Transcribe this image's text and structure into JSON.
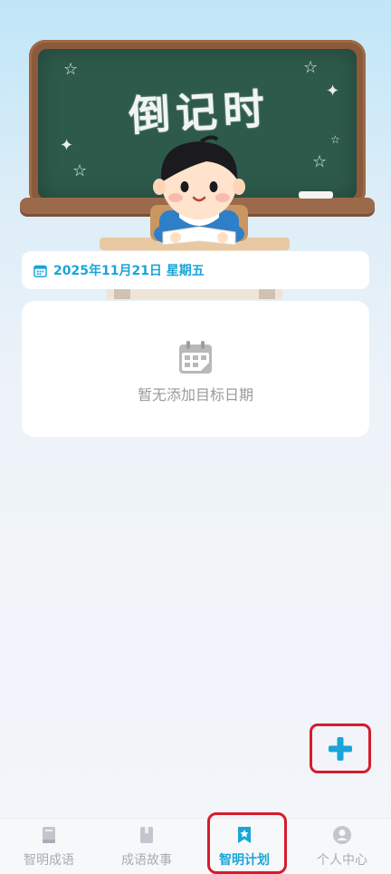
{
  "hero": {
    "board_title": "倒记时",
    "icons": [
      "star-icon",
      "sparkle-icon"
    ]
  },
  "date_bar": {
    "icon": "calendar-icon",
    "text": "2025年11月21日 星期五"
  },
  "empty_state": {
    "icon": "calendar-grid-icon",
    "text": "暂无添加目标日期"
  },
  "fab": {
    "icon": "plus-icon",
    "color": "#1aa5d9"
  },
  "bottom_nav": {
    "items": [
      {
        "label": "智明成语",
        "icon": "book-icon",
        "active": false
      },
      {
        "label": "成语故事",
        "icon": "bookmark-book-icon",
        "active": false
      },
      {
        "label": "智明计划",
        "icon": "star-bookmark-icon",
        "active": true
      },
      {
        "label": "个人中心",
        "icon": "user-icon",
        "active": false
      }
    ]
  },
  "colors": {
    "accent": "#1aa5d9",
    "inactive": "#a8acb3",
    "highlight_outline": "#d51c2c",
    "board": "#2d5a4b"
  }
}
